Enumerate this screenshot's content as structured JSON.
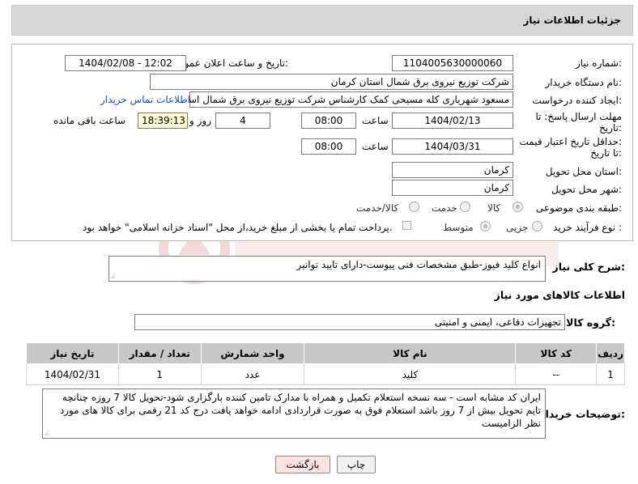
{
  "header": {
    "title": "جزئیات اطلاعات نیاز"
  },
  "form": {
    "need_number": {
      "label": "شماره نیاز:",
      "value": "1104005630000060"
    },
    "announce_datetime": {
      "label": "تاریخ و ساعت اعلان عمومی:",
      "value": "1404/02/08 - 12:02"
    },
    "buyer_org": {
      "label": "نام دستگاه خریدار:",
      "value": "شرکت توزیع نیروی برق شمال استان کرمان"
    },
    "requester": {
      "label": "ایجاد کننده درخواست:",
      "value": "مسعود شهریاری کله مسیحی کمک کارشناس شرکت توزیع نیروی برق شمال استان کرمان",
      "contact_link": "اطلاعات تماس خریدار"
    },
    "reply_deadline": {
      "label_line1": "مهلت ارسال پاسخ: تا",
      "label_line2": "تاریخ:",
      "date": "1404/02/13",
      "time_label": "ساعت",
      "time": "08:00",
      "days": "4",
      "days_label": "روز و",
      "remaining": "18:39:13",
      "remaining_label": "ساعت باقی مانده"
    },
    "price_validity": {
      "label_line1": "حداقل تاریخ اعتبار قیمت:",
      "label_line2": "تا تاریخ:",
      "date": "1404/03/31",
      "time_label": "ساعت",
      "time": "08:00"
    },
    "delivery_province": {
      "label": "استان محل تحویل:",
      "value": "کرمان"
    },
    "delivery_city": {
      "label": "شهر محل تحویل:",
      "value": "کرمان"
    },
    "category": {
      "label": "طبقه بندی موضوعی:",
      "options": [
        "کالا",
        "خدمت",
        "کالا/خدمت"
      ],
      "selected": "کالا"
    },
    "purchase_type": {
      "label": "نوع فرآیند خرید :",
      "options": [
        "جزیی",
        "متوسط"
      ],
      "selected": "متوسط",
      "payment_note": "پرداخت تمام یا بخشی از مبلغ خرید،از محل \"اسناد خزانه اسلامی\" خواهد بود."
    }
  },
  "description": {
    "label": "شرح کلی نیاز:",
    "value": "انواع کلید فیوز-طبق مشخصات فنی پیوست-دارای تایید توانیر"
  },
  "goods_section": {
    "title": "اطلاعات کالاهای مورد نیاز"
  },
  "goods_group": {
    "label": "گروه کالا:",
    "value": "تجهیزات دفاعی، ایمنی و امنیتی"
  },
  "table": {
    "headers": [
      "ردیف",
      "کد کالا",
      "نام کالا",
      "واحد شمارش",
      "تعداد / مقدار",
      "تاریخ نیاز"
    ],
    "rows": [
      [
        "1",
        "--",
        "کلید",
        "عدد",
        "1",
        "1404/02/31"
      ]
    ]
  },
  "buyer_notes": {
    "label": "توضیحات خریدار:",
    "value": "ایران کد مشابه است - سه نسخه استعلام تکمیل و همراه با مدارک تامین کننده بارگزاری شود-تحویل کالا 7 روزه چنانچه تایم تحویل بیش از 7 روز باشد استعلام فوق به صورت قراردادی ادامه خواهد یافت  درج کد 21 رقمی برای کالا های مورد نظر الزامیست"
  },
  "buttons": {
    "print": "چاپ",
    "back": "بازگشت"
  },
  "colors": {
    "header_bg": "#d7d7d7",
    "table_header_bg": "#c8c8c8",
    "remaining_bg": "#fffbd0",
    "back_button_bg": "#fbe3e3",
    "link": "#1a4fb0"
  }
}
